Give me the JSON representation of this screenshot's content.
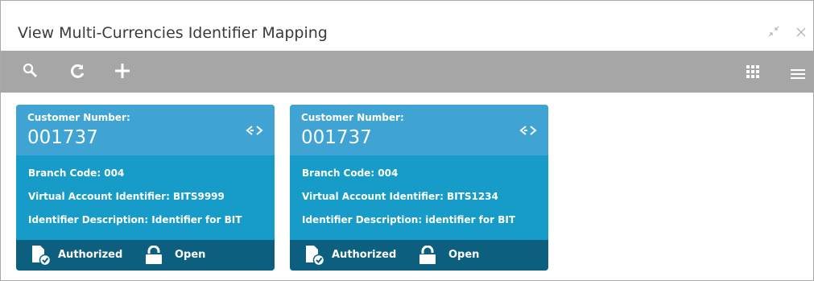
{
  "window": {
    "title": "View Multi-Currencies Identifier Mapping"
  },
  "cards": [
    {
      "customer_label": "Customer Number:",
      "customer_number": "001737",
      "branch": "Branch Code: 004",
      "virtual_account": "Virtual Account Identifier: BITS9999",
      "description": "Identifier Description: Identifier for BIT",
      "auth_status": "Authorized",
      "record_status": "Open"
    },
    {
      "customer_label": "Customer Number:",
      "customer_number": "001737",
      "branch": "Branch Code: 004",
      "virtual_account": "Virtual Account Identifier: BITS1234",
      "description": "Identifier Description: identifier for BIT",
      "auth_status": "Authorized",
      "record_status": "Open"
    }
  ],
  "colors": {
    "toolbar": "#a6a6a6",
    "card": "#179bc8",
    "card_header": "#3fa3d4",
    "card_footer": "#0d5f80"
  }
}
